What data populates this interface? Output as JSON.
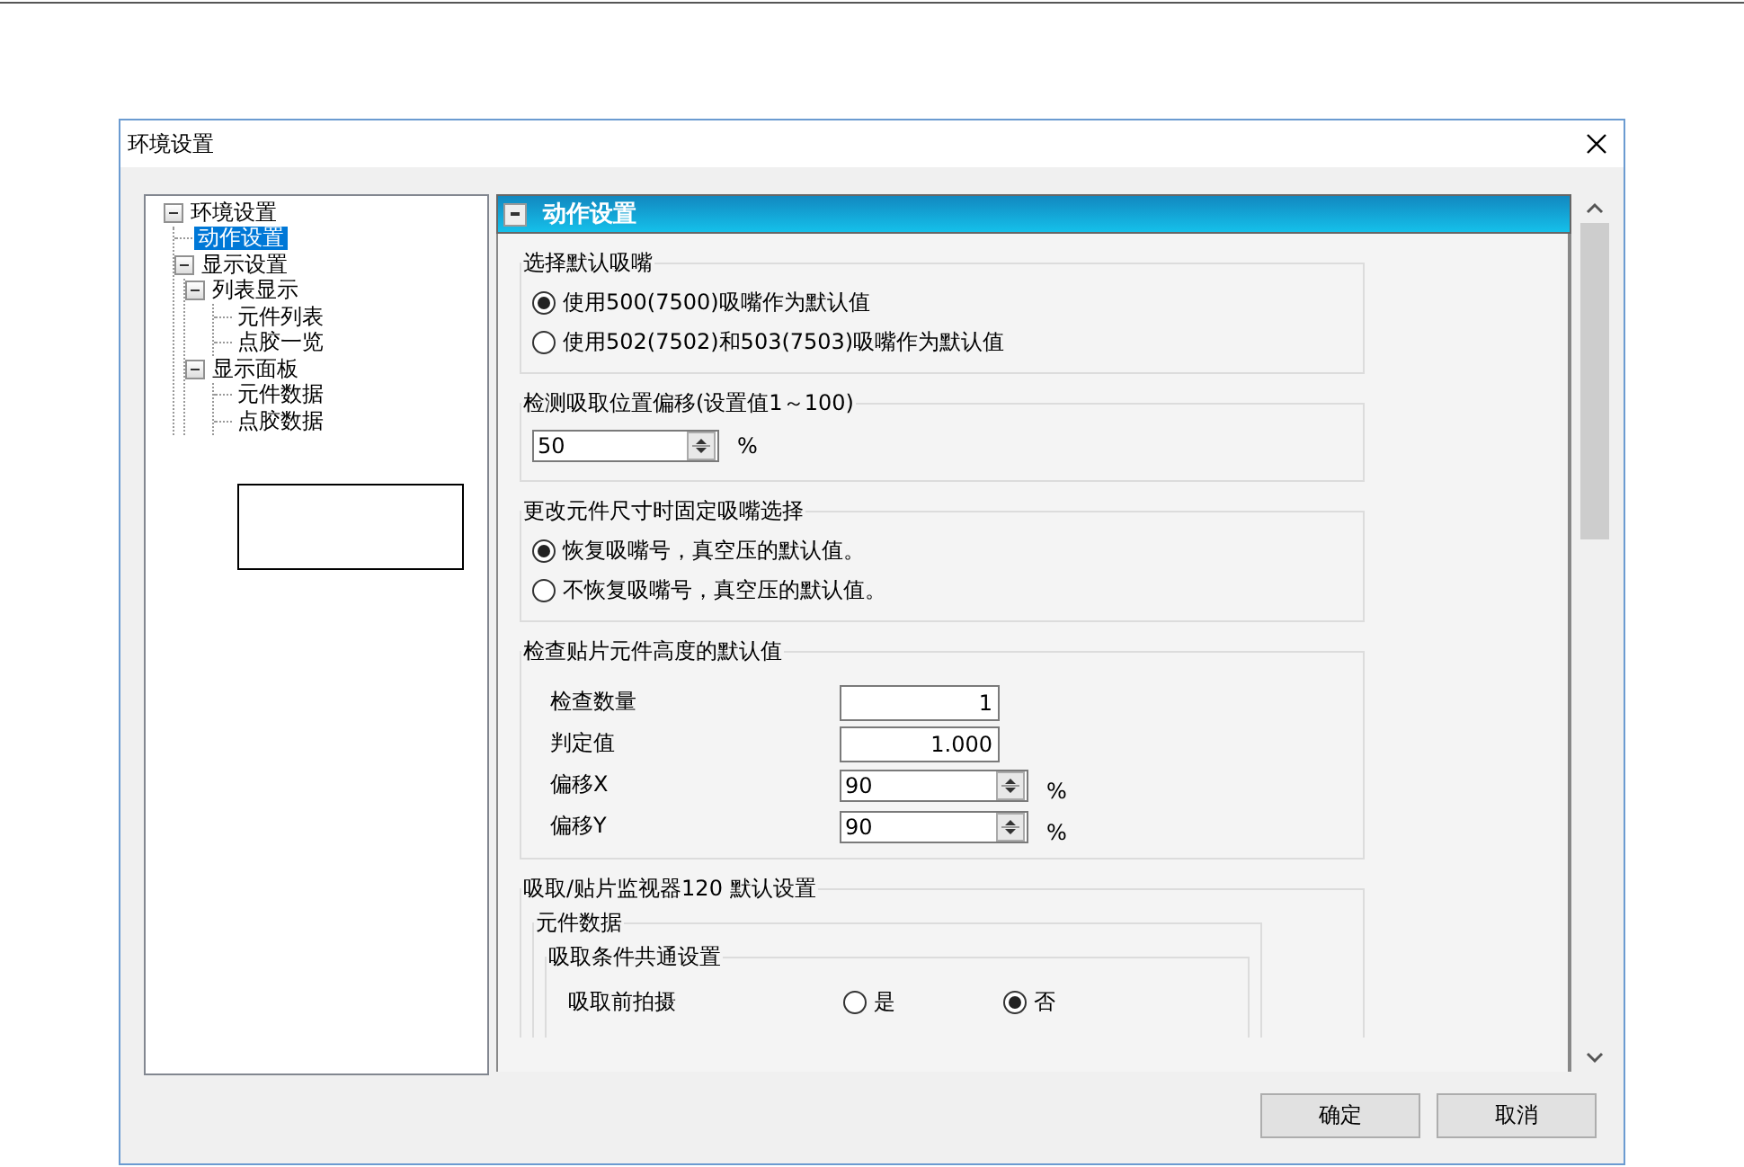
{
  "window": {
    "title": "环境设置"
  },
  "tree": [
    {
      "label": "环境设置",
      "expanded": true,
      "selected": false,
      "children": [
        {
          "label": "动作设置",
          "selected": true
        },
        {
          "label": "显示设置",
          "expanded": true,
          "selected": false,
          "children": [
            {
              "label": "列表显示",
              "expanded": true,
              "selected": false,
              "children": [
                {
                  "label": "元件列表",
                  "selected": false
                },
                {
                  "label": "点胶一览",
                  "selected": false
                }
              ]
            },
            {
              "label": "显示面板",
              "expanded": true,
              "selected": false,
              "children": [
                {
                  "label": "元件数据",
                  "selected": false
                },
                {
                  "label": "点胶数据",
                  "selected": false
                }
              ]
            }
          ]
        }
      ]
    }
  ],
  "section": {
    "title": "动作设置",
    "expanded": true
  },
  "groups": [
    {
      "kind": "radio",
      "title": "选择默认吸嘴",
      "options": [
        {
          "label": "使用500(7500)吸嘴作为默认值",
          "selected": true
        },
        {
          "label": "使用502(7502)和503(7503)吸嘴作为默认值",
          "selected": false
        }
      ]
    },
    {
      "kind": "spin",
      "title": "检测吸取位置偏移(设置值1～100)",
      "value": "50",
      "unit": "%"
    },
    {
      "kind": "radio",
      "title": "更改元件尺寸时固定吸嘴选择",
      "options": [
        {
          "label": "恢复吸嘴号，真空压的默认值。",
          "selected": true
        },
        {
          "label": "不恢复吸嘴号，真空压的默认值。",
          "selected": false
        }
      ]
    },
    {
      "kind": "fields",
      "title": "检查贴片元件高度的默认值",
      "rows": [
        {
          "kind": "text",
          "label": "检查数量",
          "value": "1"
        },
        {
          "kind": "text",
          "label": "判定值",
          "value": "1.000"
        },
        {
          "kind": "spin",
          "label": "偏移X",
          "value": "90",
          "unit": "%"
        },
        {
          "kind": "spin",
          "label": "偏移Y",
          "value": "90",
          "unit": "%"
        }
      ]
    },
    {
      "kind": "monitor",
      "title": "吸取/贴片监视器120 默认设置",
      "subgroup": {
        "title": "元件数据",
        "inner": {
          "title": "吸取条件共通设置",
          "rows": [
            {
              "label": "吸取前拍摄",
              "options": [
                {
                  "label": "是",
                  "selected": false
                },
                {
                  "label": "否",
                  "selected": true
                }
              ]
            }
          ]
        }
      }
    }
  ],
  "buttons": [
    "确定",
    "取消"
  ]
}
